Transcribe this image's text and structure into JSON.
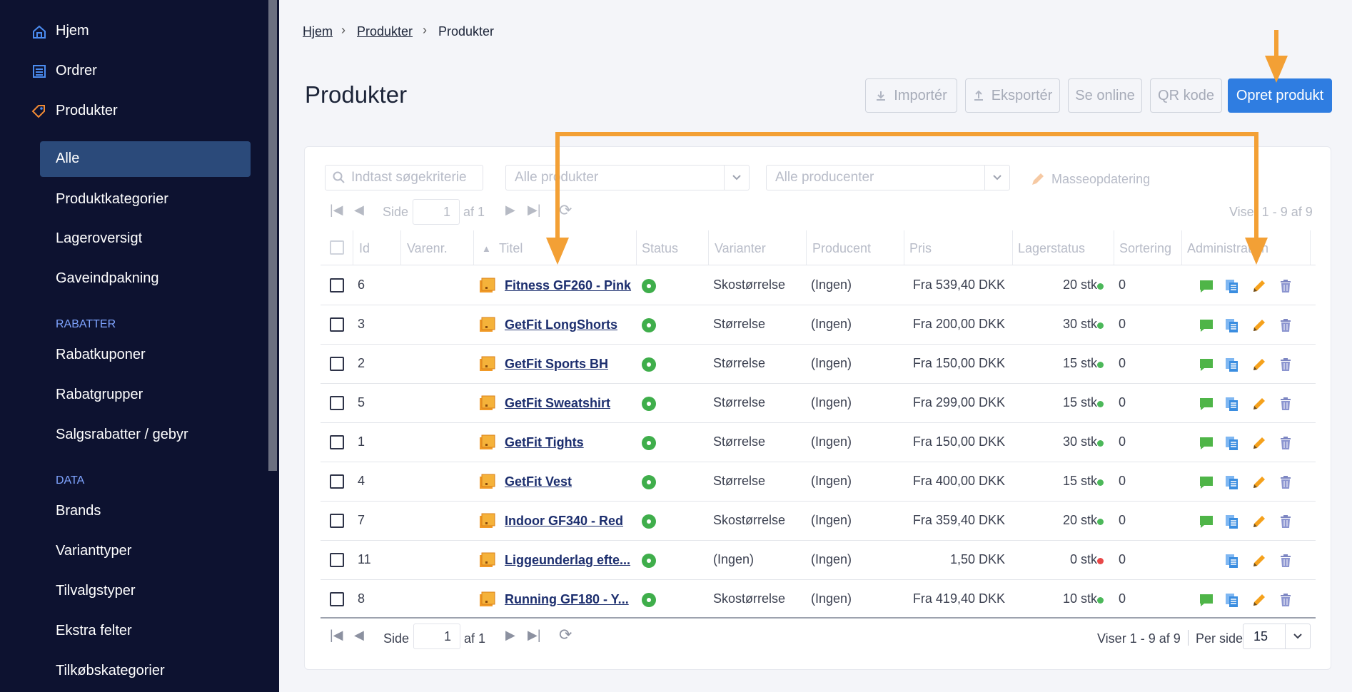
{
  "sidebar": {
    "items": [
      {
        "label": "Hjem",
        "icon": "home-icon"
      },
      {
        "label": "Ordrer",
        "icon": "orders-icon"
      },
      {
        "label": "Produkter",
        "icon": "tag-icon"
      }
    ],
    "sub_items": [
      "Alle",
      "Produktkategorier",
      "Lageroversigt",
      "Gaveindpakning"
    ],
    "section_rabatter": "RABATTER",
    "rabatter_items": [
      "Rabatkuponer",
      "Rabatgrupper",
      "Salgsrabatter / gebyr"
    ],
    "section_data": "DATA",
    "data_items": [
      "Brands",
      "Varianttyper",
      "Tilvalgstyper",
      "Ekstra felter",
      "Tilkøbskategorier"
    ]
  },
  "breadcrumb": [
    "Hjem",
    "Produkter",
    "Produkter"
  ],
  "page_title": "Produkter",
  "toolbar": {
    "import_label": "Importér",
    "export_label": "Eksportér",
    "online_label": "Se online",
    "qr_label": "QR kode",
    "create_label": "Opret produkt"
  },
  "filters": {
    "search_placeholder": "Indtast søgekriterie",
    "products_select": "Alle produkter",
    "producers_select": "Alle producenter",
    "mass_update": "Masseopdatering"
  },
  "pagination": {
    "page_label": "Side",
    "page_value": "1",
    "of_label": "af 1",
    "showing": "Viser 1 - 9 af 9",
    "per_page_label": "Per side:",
    "per_page_value": "15"
  },
  "columns": [
    "Id",
    "Varenr.",
    "Titel",
    "Status",
    "Varianter",
    "Producent",
    "Pris",
    "Lagerstatus",
    "Sortering",
    "Administration"
  ],
  "rows": [
    {
      "id": "6",
      "title": "Fitness GF260 - Pink",
      "variants": "Skostørrelse",
      "producer": "(Ingen)",
      "price": "Fra 539,40 DKK",
      "stock": "20 stk.",
      "stock_color": "#4cb85a",
      "sort": "0",
      "comment": true
    },
    {
      "id": "3",
      "title": "GetFit LongShorts",
      "variants": "Størrelse",
      "producer": "(Ingen)",
      "price": "Fra 200,00 DKK",
      "stock": "30 stk.",
      "stock_color": "#4cb85a",
      "sort": "0",
      "comment": true
    },
    {
      "id": "2",
      "title": "GetFit Sports BH",
      "variants": "Størrelse",
      "producer": "(Ingen)",
      "price": "Fra 150,00 DKK",
      "stock": "15 stk.",
      "stock_color": "#4cb85a",
      "sort": "0",
      "comment": true
    },
    {
      "id": "5",
      "title": "GetFit Sweatshirt",
      "variants": "Størrelse",
      "producer": "(Ingen)",
      "price": "Fra 299,00 DKK",
      "stock": "15 stk.",
      "stock_color": "#4cb85a",
      "sort": "0",
      "comment": true
    },
    {
      "id": "1",
      "title": "GetFit Tights",
      "variants": "Størrelse",
      "producer": "(Ingen)",
      "price": "Fra 150,00 DKK",
      "stock": "30 stk.",
      "stock_color": "#4cb85a",
      "sort": "0",
      "comment": true
    },
    {
      "id": "4",
      "title": "GetFit Vest",
      "variants": "Størrelse",
      "producer": "(Ingen)",
      "price": "Fra 400,00 DKK",
      "stock": "15 stk.",
      "stock_color": "#4cb85a",
      "sort": "0",
      "comment": true
    },
    {
      "id": "7",
      "title": "Indoor GF340 - Red",
      "variants": "Skostørrelse",
      "producer": "(Ingen)",
      "price": "Fra 359,40 DKK",
      "stock": "20 stk.",
      "stock_color": "#4cb85a",
      "sort": "0",
      "comment": true
    },
    {
      "id": "11",
      "title": "Liggeunderlag efte...",
      "variants": "(Ingen)",
      "producer": "(Ingen)",
      "price": "1,50 DKK",
      "stock": "0 stk.",
      "stock_color": "#e84848",
      "sort": "0",
      "comment": false
    },
    {
      "id": "8",
      "title": "Running GF180 - Y...",
      "variants": "Skostørrelse",
      "producer": "(Ingen)",
      "price": "Fra 419,40 DKK",
      "stock": "10 stk.",
      "stock_color": "#4cb85a",
      "sort": "0",
      "comment": true
    }
  ],
  "colors": {
    "sidebar_bg": "#0d1230",
    "accent": "#2f7de1",
    "annotation": "#f3a035",
    "status_green": "#3fae4b"
  }
}
